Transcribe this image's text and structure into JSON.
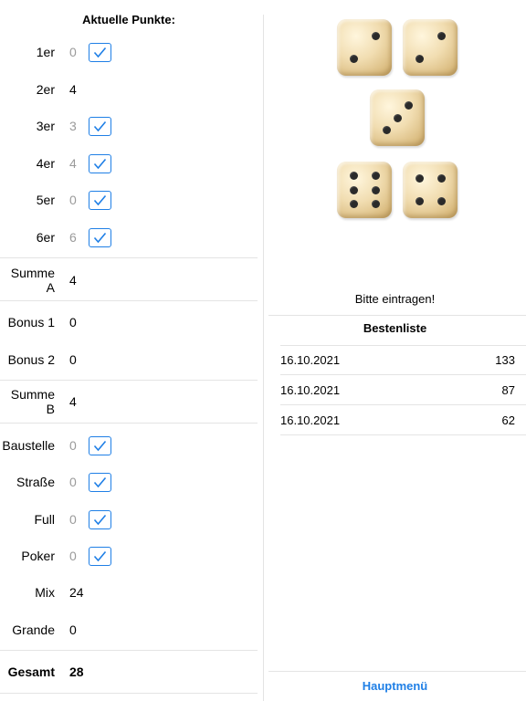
{
  "score": {
    "heading": "Aktuelle Punkte:",
    "rows": [
      {
        "label": "1er",
        "value": "0",
        "checked": true
      },
      {
        "label": "2er",
        "value": "4",
        "checked": false
      },
      {
        "label": "3er",
        "value": "3",
        "checked": true
      },
      {
        "label": "4er",
        "value": "4",
        "checked": true
      },
      {
        "label": "5er",
        "value": "0",
        "checked": true
      },
      {
        "label": "6er",
        "value": "6",
        "checked": true
      },
      {
        "label": "Summe A",
        "value": "4",
        "checked": false
      },
      {
        "label": "Bonus 1",
        "value": "0",
        "checked": false
      },
      {
        "label": "Bonus 2",
        "value": "0",
        "checked": false
      },
      {
        "label": "Summe B",
        "value": "4",
        "checked": false
      },
      {
        "label": "Baustelle",
        "value": "0",
        "checked": true
      },
      {
        "label": "Straße",
        "value": "0",
        "checked": true
      },
      {
        "label": "Full",
        "value": "0",
        "checked": true
      },
      {
        "label": "Poker",
        "value": "0",
        "checked": true
      },
      {
        "label": "Mix",
        "value": "24",
        "checked": false
      },
      {
        "label": "Grande",
        "value": "0",
        "checked": false
      },
      {
        "label": "Gesamt",
        "value": "28",
        "checked": false
      }
    ]
  },
  "dice": [
    2,
    2,
    3,
    6,
    4
  ],
  "status": {
    "hint": "Bitte eintragen!"
  },
  "highscores": {
    "title": "Bestenliste",
    "entries": [
      {
        "date": "16.10.2021",
        "points": "133"
      },
      {
        "date": "16.10.2021",
        "points": "87"
      },
      {
        "date": "16.10.2021",
        "points": "62"
      }
    ]
  },
  "footer": {
    "main_menu": "Hauptmenü"
  },
  "colors": {
    "accent": "#1f7fe6",
    "muted": "#9a9a9a",
    "separator": "#e4e4e4"
  }
}
